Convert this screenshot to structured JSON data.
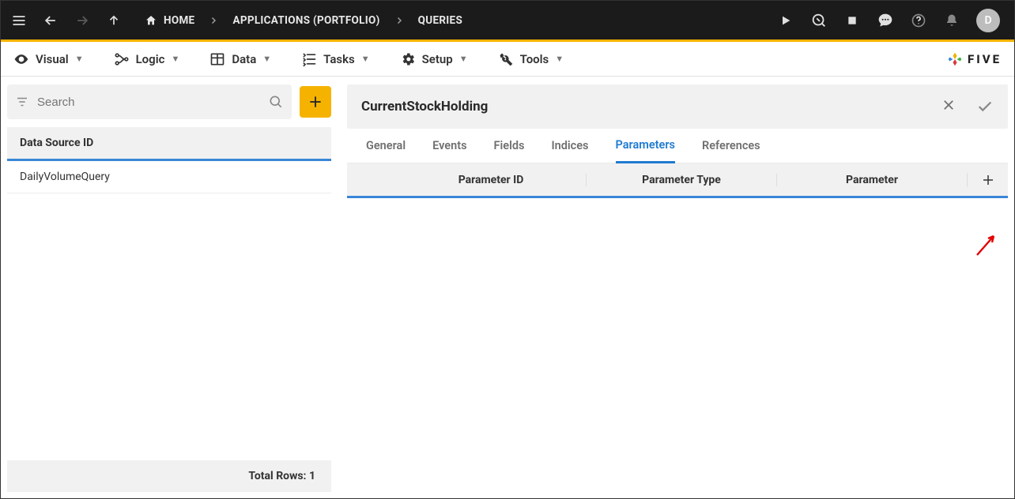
{
  "topbar": {
    "home_label": "HOME",
    "apps_label": "APPLICATIONS (PORTFOLIO)",
    "queries_label": "QUERIES",
    "avatar_letter": "D"
  },
  "menu": {
    "visual": "Visual",
    "logic": "Logic",
    "data": "Data",
    "tasks": "Tasks",
    "setup": "Setup",
    "tools": "Tools",
    "brand": "FIVE"
  },
  "left": {
    "search_placeholder": "Search",
    "column_header": "Data Source ID",
    "items": [
      "DailyVolumeQuery"
    ],
    "footer": "Total Rows: 1"
  },
  "detail": {
    "title": "CurrentStockHolding",
    "tabs": {
      "general": "General",
      "events": "Events",
      "fields": "Fields",
      "indices": "Indices",
      "parameters": "Parameters",
      "references": "References"
    },
    "param_cols": {
      "c1": "Parameter ID",
      "c2": "Parameter Type",
      "c3": "Parameter"
    }
  }
}
